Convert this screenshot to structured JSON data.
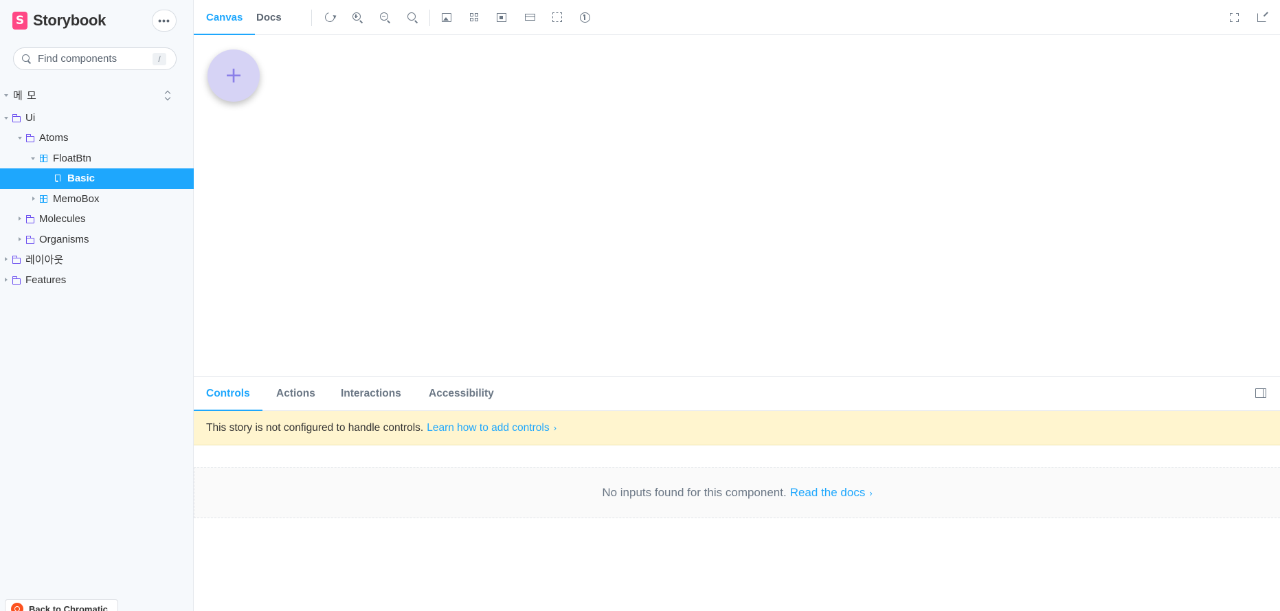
{
  "app": {
    "name": "Storybook",
    "logo_letter": "S",
    "brand_color": "#ff4785",
    "accent_color": "#1ea7fd"
  },
  "sidebar": {
    "menu_icon": "ellipsis-icon",
    "search": {
      "placeholder": "Find components",
      "shortcut": "/"
    },
    "root_label": "메 모",
    "tree": [
      {
        "label": "Ui",
        "type": "folder",
        "expanded": true
      },
      {
        "label": "Atoms",
        "type": "folder",
        "expanded": true
      },
      {
        "label": "FloatBtn",
        "type": "component",
        "expanded": true
      },
      {
        "label": "Basic",
        "type": "story",
        "selected": true
      },
      {
        "label": "MemoBox",
        "type": "component",
        "expanded": false
      },
      {
        "label": "Molecules",
        "type": "folder",
        "expanded": false
      },
      {
        "label": "Organisms",
        "type": "folder",
        "expanded": false
      },
      {
        "label": "레이아웃",
        "type": "folder",
        "expanded": false
      },
      {
        "label": "Features",
        "type": "folder",
        "expanded": false
      }
    ],
    "chromatic_label": "Back to Chromatic"
  },
  "toolbar": {
    "tabs": [
      {
        "label": "Canvas",
        "active": true
      },
      {
        "label": "Docs",
        "active": false
      }
    ],
    "tools": [
      "reload-icon",
      "zoom-in-icon",
      "zoom-out-icon",
      "zoom-reset-icon",
      "background-icon",
      "grid-icon",
      "viewport-icon",
      "measure-icon",
      "outline-icon",
      "accessibility-icon"
    ],
    "right_tools": [
      "fullscreen-icon",
      "open-new-tab-icon"
    ]
  },
  "canvas": {
    "fab_symbol": "+",
    "fab_color": "#d6d3f5",
    "fab_symbol_color": "#8a7fe8"
  },
  "panel": {
    "tabs": [
      {
        "label": "Controls",
        "active": true
      },
      {
        "label": "Actions",
        "active": false
      },
      {
        "label": "Interactions",
        "active": false
      },
      {
        "label": "Accessibility",
        "active": false
      }
    ],
    "warning": {
      "text": "This story is not configured to handle controls.",
      "link": "Learn how to add controls",
      "bg_color": "#fff5cf"
    },
    "empty": {
      "text": "No inputs found for this component.",
      "link": "Read the docs"
    }
  }
}
